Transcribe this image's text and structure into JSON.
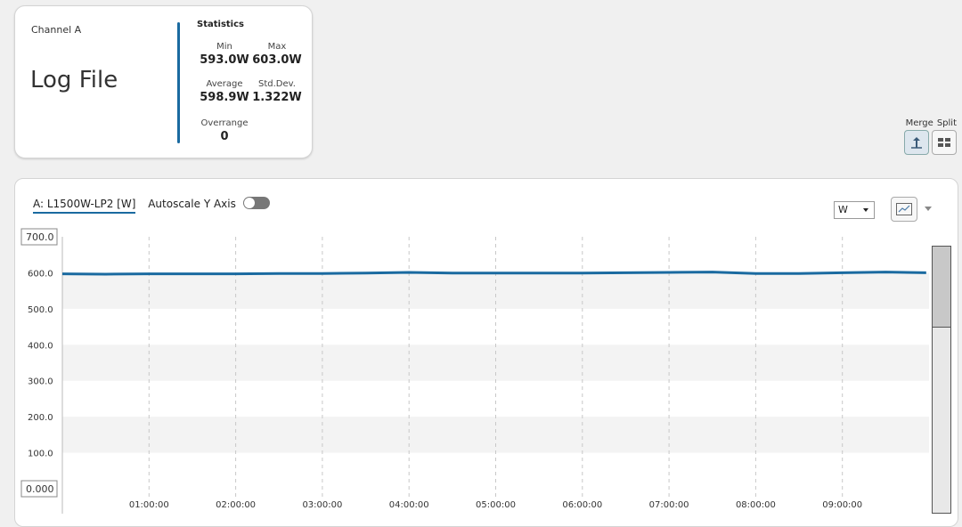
{
  "channel_card": {
    "channel_name": "Channel A",
    "source_title": "Log File",
    "stats_heading": "Statistics",
    "min_label": "Min",
    "min_value": "593.0W",
    "max_label": "Max",
    "max_value": "603.0W",
    "avg_label": "Average",
    "avg_value": "598.9W",
    "std_label": "Std.Dev.",
    "std_value": "1.322W",
    "overrange_label": "Overrange",
    "overrange_value": "0"
  },
  "view_mode": {
    "merge_label": "Merge",
    "split_label": "Split",
    "active": "merge"
  },
  "chart_panel": {
    "series_label": "A: L1500W-LP2 [W]",
    "autoscale_label": "Autoscale Y Axis",
    "autoscale_on": false,
    "unit_selected": "W",
    "chart_type_icon": "line-chart-icon"
  },
  "colors": {
    "series": "#1a6aa0",
    "band": "#f3f3f3",
    "grid": "#c8c8c8"
  },
  "chart_data": {
    "type": "line",
    "xlabel": "",
    "ylabel": "",
    "ylim": [
      0,
      700
    ],
    "xlim_hours": [
      0,
      10
    ],
    "y_ticks": [
      "0.000",
      "100.0",
      "200.0",
      "300.0",
      "400.0",
      "500.0",
      "600.0",
      "700.0"
    ],
    "x_ticks": [
      "01:00:00",
      "02:00:00",
      "03:00:00",
      "04:00:00",
      "05:00:00",
      "06:00:00",
      "07:00:00",
      "08:00:00",
      "09:00:00"
    ],
    "grid": "vertical dashed, horizontal bands",
    "series": [
      {
        "x": [
          "00:00:00",
          "00:30:00",
          "01:00:00",
          "01:30:00",
          "02:00:00",
          "02:30:00",
          "03:00:00",
          "03:30:00",
          "04:00:00",
          "04:30:00",
          "05:00:00",
          "05:30:00",
          "06:00:00",
          "06:30:00",
          "07:00:00",
          "07:30:00",
          "08:00:00",
          "08:30:00",
          "09:00:00",
          "09:30:00",
          "09:58:00"
        ],
        "values": [
          597,
          596,
          597,
          597,
          597,
          598,
          598,
          599,
          601,
          599,
          599,
          599,
          599,
          600,
          601,
          602,
          598,
          598,
          600,
          602,
          600
        ]
      }
    ]
  }
}
